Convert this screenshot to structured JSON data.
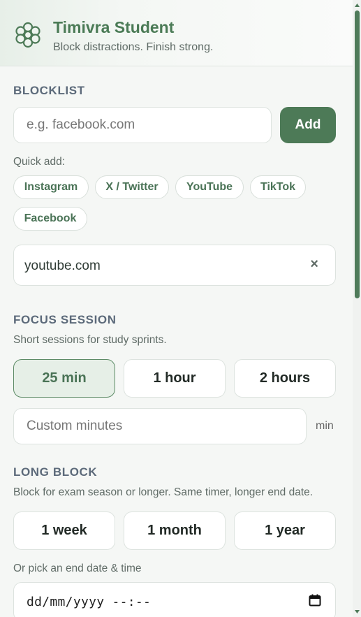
{
  "app": {
    "title": "Timivra Student",
    "subtitle": "Block distractions. Finish strong.",
    "logo_icon": "flower-icon",
    "accent": "#4d7a57"
  },
  "blocklist": {
    "heading": "BLOCKLIST",
    "input_placeholder": "e.g. facebook.com",
    "add_label": "Add",
    "quick_add_label": "Quick add:",
    "quick_add": [
      "Instagram",
      "X / Twitter",
      "YouTube",
      "TikTok",
      "Facebook"
    ],
    "items": [
      {
        "domain": "youtube.com",
        "remove_label": "×"
      }
    ]
  },
  "focus": {
    "heading": "FOCUS SESSION",
    "description": "Short sessions for study sprints.",
    "options": [
      "25 min",
      "1 hour",
      "2 hours"
    ],
    "selected": "25 min",
    "custom_placeholder": "Custom minutes",
    "custom_unit": "min"
  },
  "long_block": {
    "heading": "LONG BLOCK",
    "description": "Block for exam season or longer. Same timer, longer end date.",
    "options": [
      "1 week",
      "1 month",
      "1 year"
    ],
    "end_label": "Or pick an end date & time",
    "datetime_value": "dd/mm/yyyy --:--"
  }
}
